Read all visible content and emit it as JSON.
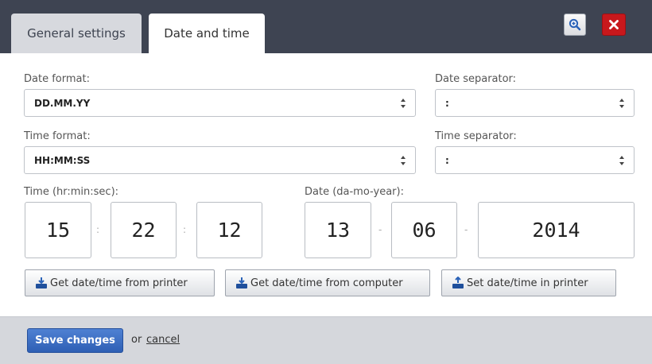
{
  "tabs": [
    {
      "label": "General settings"
    },
    {
      "label": "Date and time"
    }
  ],
  "form": {
    "date_format": {
      "label": "Date format:",
      "value": "DD.MM.YY"
    },
    "date_separator": {
      "label": "Date separator:",
      "value": ":"
    },
    "time_format": {
      "label": "Time format:",
      "value": "HH:MM:SS"
    },
    "time_separator": {
      "label": "Time separator:",
      "value": ":"
    },
    "time": {
      "label": "Time (hr:min:sec):",
      "hour": "15",
      "minute": "22",
      "second": "12",
      "separator": ":"
    },
    "date": {
      "label": "Date (da-mo-year):",
      "day": "13",
      "month": "06",
      "year": "2014",
      "separator": "-"
    }
  },
  "actions": {
    "from_printer": "Get date/time from printer",
    "from_computer": "Get date/time from computer",
    "set_in_printer": "Set date/time in printer"
  },
  "footer": {
    "save_label": "Save changes",
    "or_text": "or",
    "cancel_label": "cancel"
  },
  "colors": {
    "header_bg": "#3e4452",
    "close_red": "#c8181c",
    "save_blue": "#2e5fb4",
    "footer_bg": "#d5d7dc"
  }
}
